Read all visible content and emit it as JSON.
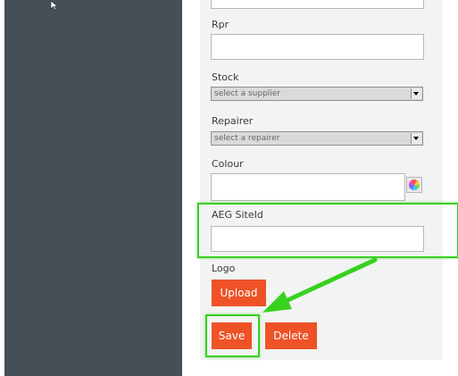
{
  "sidebar": {
    "cursor_icon": "mouse-cursor-icon"
  },
  "form": {
    "rpr_label": "Rpr",
    "rpr_value": "",
    "stock_label": "Stock",
    "stock_selected": "select a supplier",
    "repairer_label": "Repairer",
    "repairer_selected": "select a repairer",
    "colour_label": "Colour",
    "colour_value": "",
    "colour_picker_icon": "color-wheel-icon",
    "aeg_label": "AEG SiteId",
    "aeg_value": "",
    "logo_label": "Logo",
    "upload_label": "Upload",
    "save_label": "Save",
    "delete_label": "Delete"
  },
  "colors": {
    "sidebar": "#454f55",
    "panel": "#f2f3f3",
    "button": "#ee5226",
    "highlight": "#37d11f"
  },
  "annotations": {
    "highlight_color": "#37d11f",
    "arrow_icon": "green-arrow-icon"
  }
}
